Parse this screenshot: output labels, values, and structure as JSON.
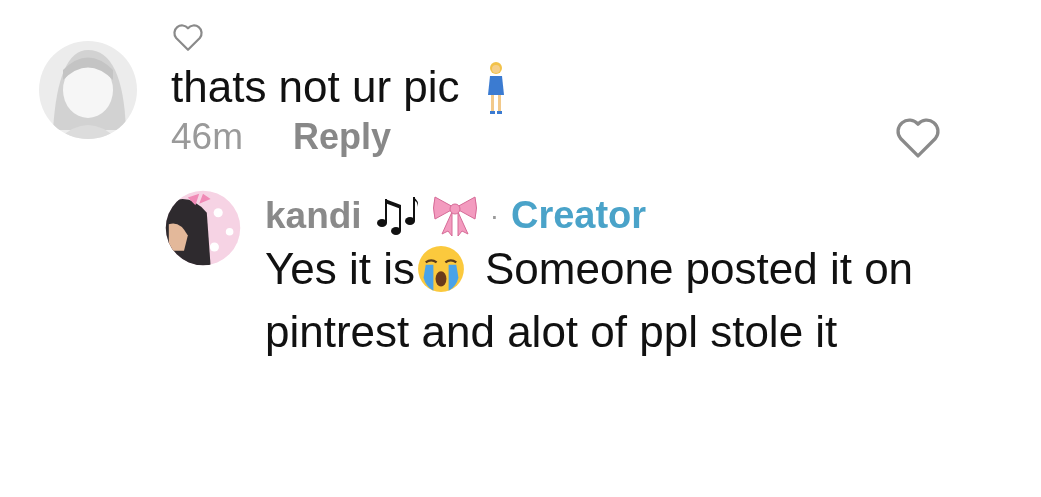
{
  "comment": {
    "liked": false,
    "text": "thats not ur pic",
    "time": "46m",
    "reply_label": "Reply"
  },
  "reply": {
    "username": "kandi",
    "separator": "·",
    "badge": "Creator",
    "text_before": "Yes it is",
    "text_lines": [
      "Someone posted it on",
      "pintrest and alot of ppl stole it"
    ]
  }
}
